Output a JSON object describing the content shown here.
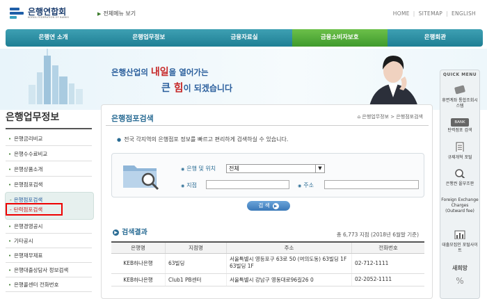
{
  "header": {
    "logo_title": "은행연합회",
    "logo_sub": "KOREA FEDERATION OF BANKS",
    "all_menu": "전체메뉴 보기",
    "util_links": [
      "HOME",
      "SITEMAP",
      "ENGLISH"
    ]
  },
  "nav": {
    "items": [
      "은행연 소개",
      "은행업무정보",
      "금융자료실",
      "금융소비자보호",
      "은행회관"
    ]
  },
  "banner": {
    "line1_a": "은행산업의 ",
    "line1_b": "내일",
    "line1_c": "을 열어가는",
    "line2_a": "큰 ",
    "line2_b": "힘",
    "line2_c": "이 되겠습니다"
  },
  "sidebar": {
    "title": "은행업무정보",
    "items": [
      "은행금리비교",
      "은행수수료비교",
      "은행상품소개",
      "은행점포검색",
      "은행경영공시",
      "기타공시",
      "은행재무제표",
      "은행대출상담사 정보검색",
      "은행콜센터 전화번호"
    ],
    "sub_items": [
      "은행점포검색",
      "탄력점포검색"
    ]
  },
  "main": {
    "title": "은행점포검색",
    "breadcrumb": "은행업무정보 > 은행점포검색",
    "description": "전국 각지역의 은행점포 정보를 빠르고 편리하게 검색하실 수 있습니다.",
    "search": {
      "bank_label": "은행 및 위치",
      "bank_value": "전체",
      "branch_label": "지점",
      "address_label": "주소",
      "button": "검 색"
    },
    "results": {
      "title": "검색결과",
      "count": "총 6,773 지점 (2018년 6월말 기준)",
      "headers": [
        "은행명",
        "지점명",
        "주소",
        "전화번호"
      ],
      "rows": [
        [
          "KEB하나은행",
          "63빌딩",
          "서울특별시 영등포구 63로 50 (여의도동) 63빌딩 1F 63빌딩 1F",
          "02-712-1111"
        ],
        [
          "KEB하나은행",
          "Club1 PB센터",
          "서울특별시 강남구 영동대로96길26 0",
          "02-2052-1111"
        ]
      ]
    }
  },
  "quick_menu": {
    "title": "QUICK MENU",
    "items": [
      "휴면계좌 통합조회시스템",
      "탄력점포 검색",
      "규제개혁 포털",
      "은행권 올부조판",
      "Foreign Exchange Charges (Outward fee)",
      "대출모집인 포털사이트"
    ],
    "bank_badge": "BANK",
    "bottom_logo": "새희망"
  },
  "colors": {
    "nav": "#1f7f94",
    "nav_highlight": "#3f9a2c",
    "accent_blue": "#2a6c94",
    "accent_red": "#c62828"
  }
}
